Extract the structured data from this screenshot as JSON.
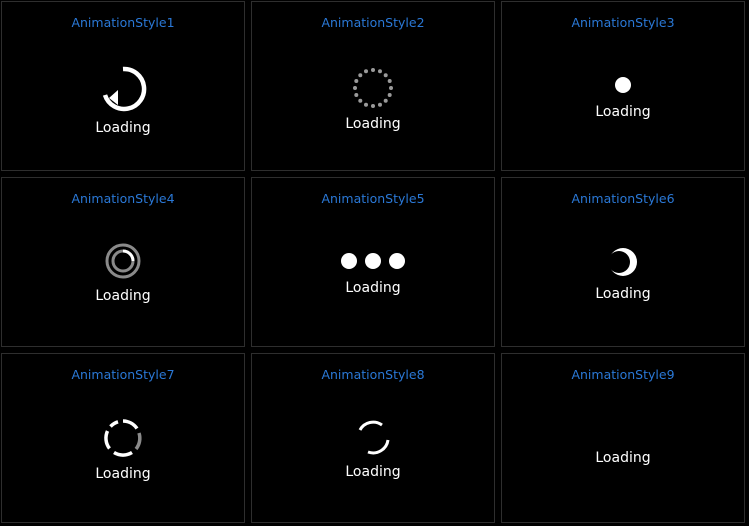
{
  "cells": [
    {
      "title": "AnimationStyle1",
      "label": "Loading",
      "icon": "arrow-circle-refresh-icon"
    },
    {
      "title": "AnimationStyle2",
      "label": "Loading",
      "icon": "dot-ring-spinner-icon"
    },
    {
      "title": "AnimationStyle3",
      "label": "Loading",
      "icon": "single-dot-icon"
    },
    {
      "title": "AnimationStyle4",
      "label": "Loading",
      "icon": "double-ring-spinner-icon"
    },
    {
      "title": "AnimationStyle5",
      "label": "Loading",
      "icon": "three-dots-icon"
    },
    {
      "title": "AnimationStyle6",
      "label": "Loading",
      "icon": "crescent-spinner-icon"
    },
    {
      "title": "AnimationStyle7",
      "label": "Loading",
      "icon": "segmented-ring-spinner-icon"
    },
    {
      "title": "AnimationStyle8",
      "label": "Loading",
      "icon": "split-arc-spinner-icon"
    },
    {
      "title": "AnimationStyle9",
      "label": "Loading",
      "icon": "none"
    }
  ],
  "colors": {
    "background": "#000000",
    "title": "#2a78d6",
    "label": "#ffffff",
    "border": "#2e2e2e"
  }
}
